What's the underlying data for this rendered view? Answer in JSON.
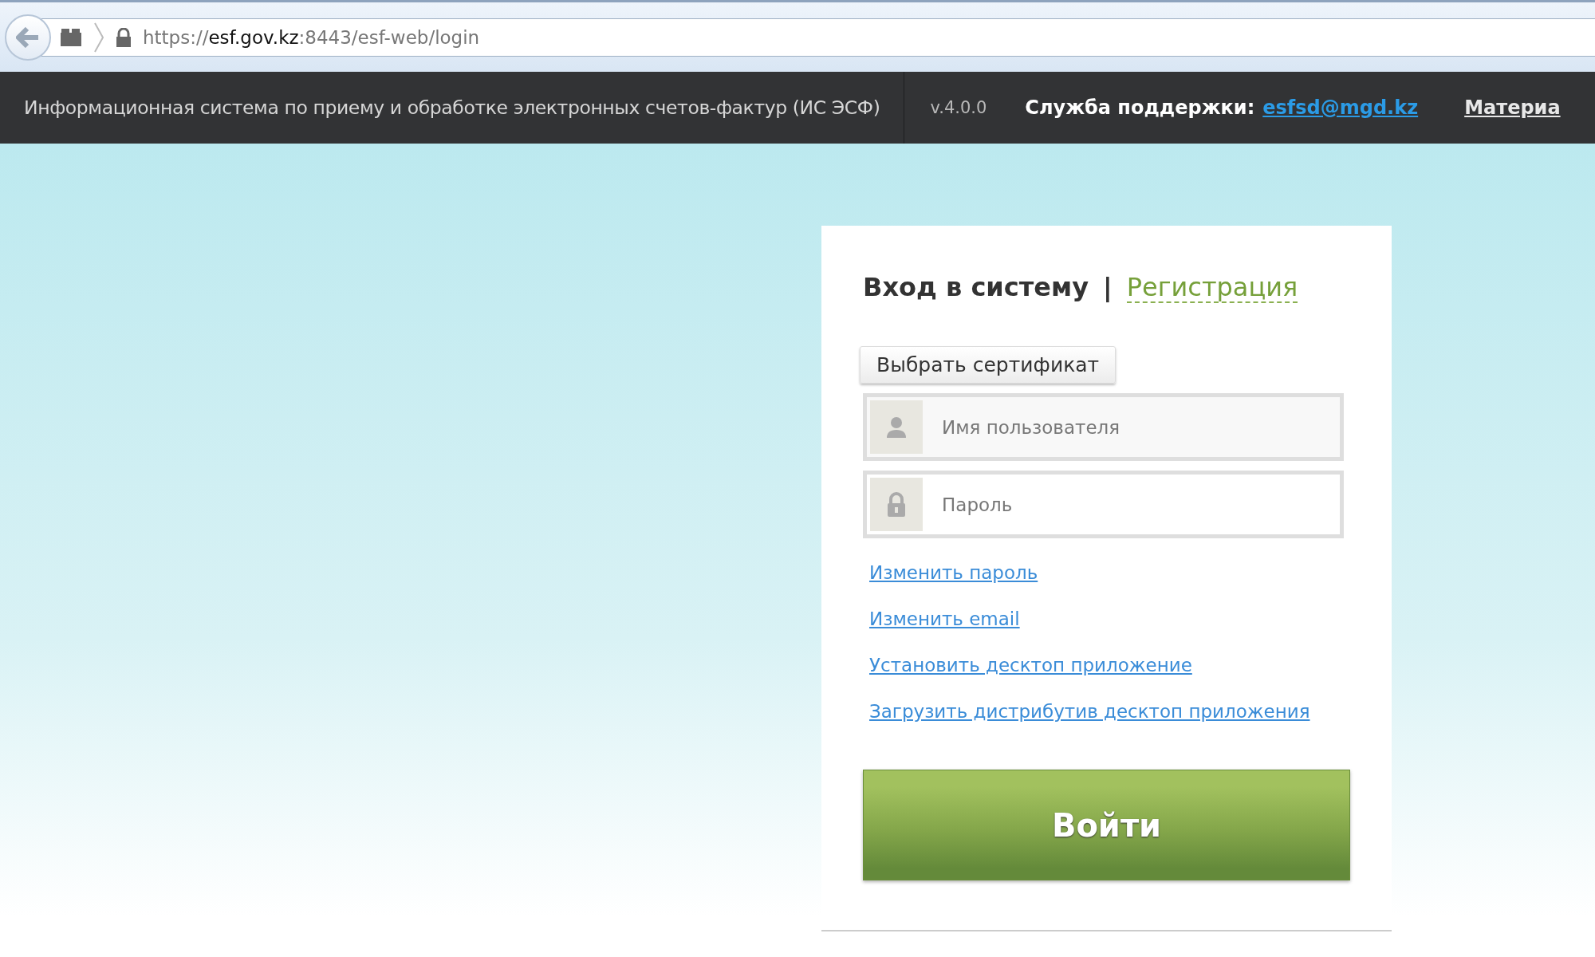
{
  "browser": {
    "url": "https://**esf.gov.kz**:8443/esf-web/login"
  },
  "header": {
    "title": "Информационная система по приему и обработке электронных счетов-фактур (ИС ЭСФ)",
    "version": "v.4.0.0",
    "support_label": "Служба поддержки:",
    "support_email": "esfsd@mgd.kz",
    "materials_link": "Материа"
  },
  "login_card": {
    "tabs": [
      {
        "label": "Вход в систему",
        "selected": true
      },
      {
        "label": "Регистрация",
        "selected": false
      }
    ],
    "separator": "|",
    "certificate_button": "Выбрать сертификат",
    "fields": [
      {
        "kind": "user",
        "placeholder": "Имя пользователя"
      },
      {
        "kind": "password",
        "placeholder": "Пароль"
      }
    ],
    "links": [
      "Изменить пароль",
      "Изменить email",
      "Установить десктоп приложение",
      "Загрузить дистрибутив десктоп приложения"
    ],
    "submit_button": "Войти"
  }
}
